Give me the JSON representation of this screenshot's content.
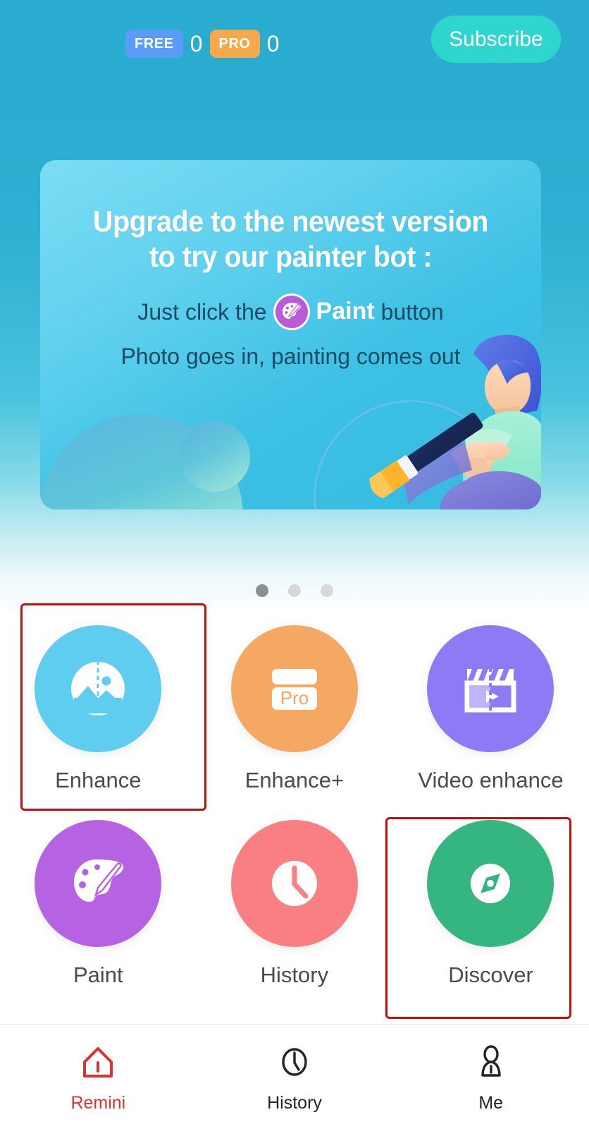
{
  "topbar": {
    "free_chip": "FREE",
    "free_count": "0",
    "pro_chip": "PRO",
    "pro_count": "0",
    "subscribe_label": "Subscribe",
    "subscribe_color": "#2fd6cd",
    "free_chip_color": "#5a9cf8",
    "pro_chip_color": "#f5a94a",
    "background_color": "#2aabd0"
  },
  "banner": {
    "headline_line1": "Upgrade to the newest version",
    "headline_line2": "to try our painter bot :",
    "sub_prefix": "Just click the",
    "sub_paint": "Paint",
    "sub_suffix": "button",
    "sub_line2": "Photo goes in, painting comes out",
    "badge_icon": "palette-icon",
    "headline_color": "#ffffff",
    "subtext_color": "#1d4a63",
    "card_color": "#63d2ef"
  },
  "carousel": {
    "dots": [
      {
        "active": true
      },
      {
        "active": false
      },
      {
        "active": false
      }
    ]
  },
  "features": {
    "rows": [
      [
        {
          "label": "Enhance",
          "icon": "image-compare-icon",
          "color": "#5ecdf0",
          "highlighted": true
        },
        {
          "label": "Enhance+",
          "icon": "pro-card-icon",
          "color": "#f5a862",
          "highlighted": false
        },
        {
          "label": "Video enhance",
          "icon": "clapperboard-play-icon",
          "color": "#8d7bf5",
          "highlighted": false
        }
      ],
      [
        {
          "label": "Paint",
          "icon": "palette-brush-icon",
          "color": "#b663e3",
          "highlighted": false
        },
        {
          "label": "History",
          "icon": "clock-icon",
          "color": "#fa7f82",
          "highlighted": false
        },
        {
          "label": "Discover",
          "icon": "compass-icon",
          "color": "#35b57f",
          "highlighted": true
        }
      ]
    ],
    "pro_card_text": "Pro",
    "annotation_color": "#c90c0c"
  },
  "bottom_nav": {
    "items": [
      {
        "label": "Remini",
        "icon": "home-icon",
        "active": true
      },
      {
        "label": "History",
        "icon": "clock-icon",
        "active": false
      },
      {
        "label": "Me",
        "icon": "person-icon",
        "active": false
      }
    ],
    "active_color": "#e0322c",
    "inactive_color": "#232323"
  }
}
